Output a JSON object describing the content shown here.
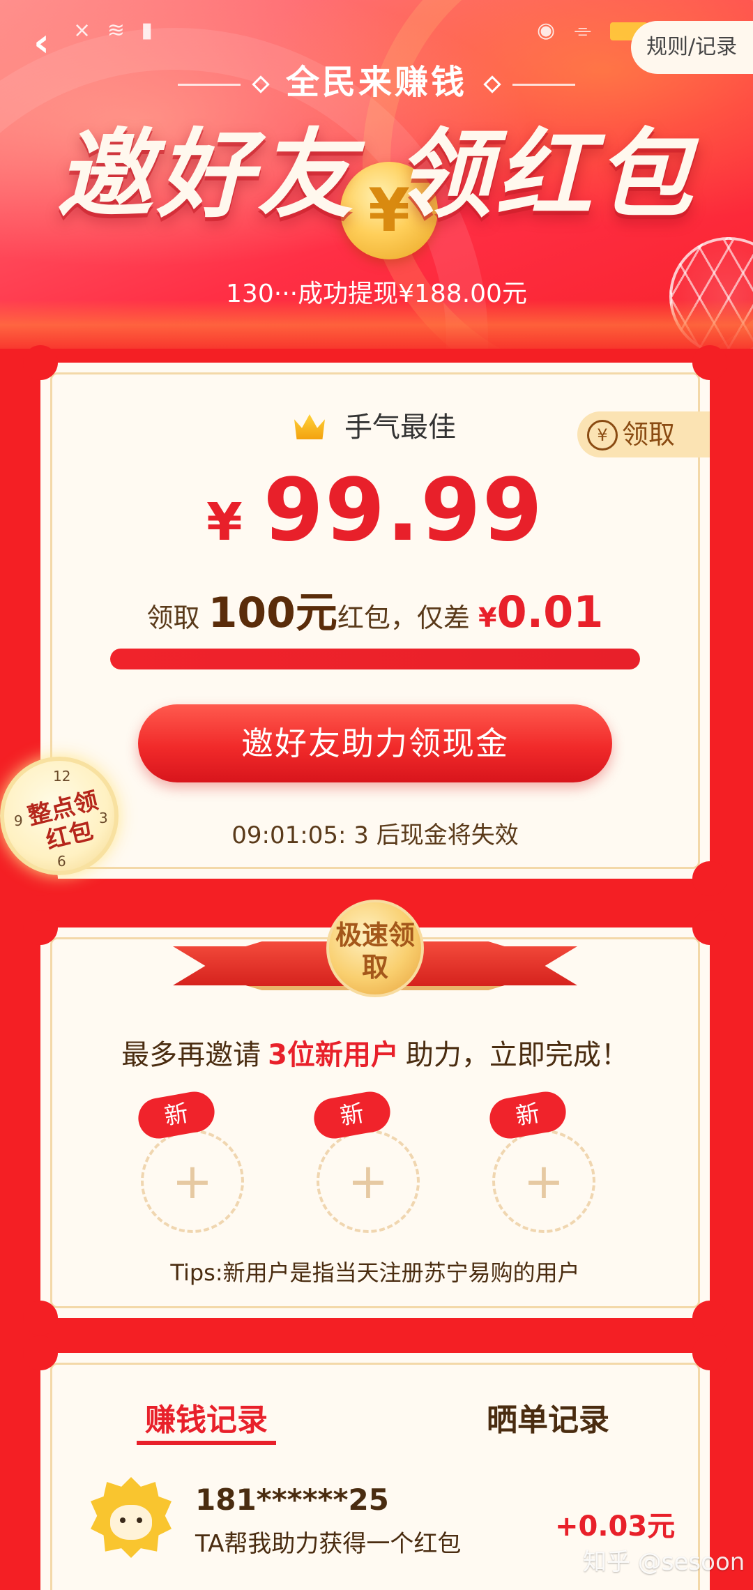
{
  "hero": {
    "subtitle": "全民来赚钱",
    "title": "邀好友 领红包",
    "coin_symbol": "¥",
    "ticker": "130···成功提现¥188.00元",
    "rules_label": "规则/记录"
  },
  "status_bar": {
    "back_icon": "chevron-left-icon",
    "left_icons": [
      "close-icon",
      "wifi-icon",
      "battery-alert-icon"
    ],
    "right_icons": [
      "eye-icon",
      "mute-icon",
      "battery-icon"
    ]
  },
  "prize_card": {
    "best_label": "手气最佳",
    "claim_icon_text": "¥",
    "claim_label": "领取",
    "currency": "¥",
    "amount": "99.99",
    "goal_prefix": "领取",
    "goal_amount": "100元",
    "goal_middle": "红包，仅差",
    "gap_currency": "¥",
    "gap_amount": "0.01",
    "progress": 0.9999,
    "invite_button": "邀好友助力领现金",
    "countdown": "09:01:05: 3  后现金将失效"
  },
  "clock_badge": {
    "text": "整点领红包",
    "numbers": [
      "12",
      "3",
      "6",
      "9"
    ]
  },
  "invite_card": {
    "medal_text": "极速领取",
    "info_prefix": "最多再邀请",
    "info_highlight": "3位新用户",
    "info_suffix": "助力，立即完成！",
    "slots": [
      {
        "tag": "新",
        "icon": "+"
      },
      {
        "tag": "新",
        "icon": "+"
      },
      {
        "tag": "新",
        "icon": "+"
      }
    ],
    "tips": "Tips:新用户是指当天注册苏宁易购的用户"
  },
  "records_card": {
    "tabs": [
      "赚钱记录",
      "晒单记录"
    ],
    "records": [
      {
        "phone": "181******25",
        "desc": "TA帮我助力获得一个红包",
        "amount": "+0.03元"
      }
    ]
  },
  "watermark": "知乎 @sesoon",
  "colors": {
    "primary_red": "#e8202a",
    "background_red": "#f41f24",
    "card_bg": "#fffaf2",
    "gold": "#f9c52f"
  }
}
